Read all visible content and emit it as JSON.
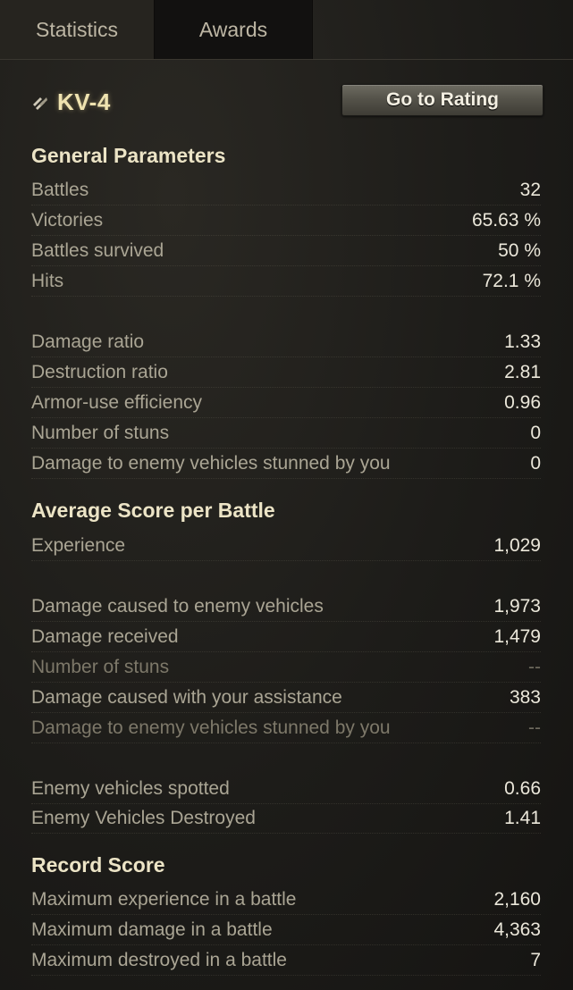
{
  "tabs": [
    {
      "label": "Statistics"
    },
    {
      "label": "Awards"
    }
  ],
  "vehicle": {
    "name": "KV-4",
    "icon": "heavy-tank-icon"
  },
  "rating_button": {
    "label": "Go to Rating"
  },
  "general": {
    "title": "General Parameters",
    "rows": [
      {
        "label": "Battles",
        "value": "32"
      },
      {
        "label": "Victories",
        "value": "65.63 %"
      },
      {
        "label": "Battles survived",
        "value": "50 %"
      },
      {
        "label": "Hits",
        "value": "72.1 %"
      },
      {
        "label": "Damage ratio",
        "value": "1.33"
      },
      {
        "label": "Destruction ratio",
        "value": "2.81"
      },
      {
        "label": "Armor-use efficiency",
        "value": "0.96"
      },
      {
        "label": "Number of stuns",
        "value": "0"
      },
      {
        "label": "Damage to enemy vehicles stunned by you",
        "value": "0"
      }
    ]
  },
  "average": {
    "title": "Average Score per Battle",
    "rows": [
      {
        "label": "Experience",
        "value": "1,029"
      },
      {
        "label": "Damage caused to enemy vehicles",
        "value": "1,973"
      },
      {
        "label": "Damage received",
        "value": "1,479"
      },
      {
        "label": "Number of stuns",
        "value": "--"
      },
      {
        "label": "Damage caused with your assistance",
        "value": "383"
      },
      {
        "label": "Damage to enemy vehicles stunned by you",
        "value": "--"
      },
      {
        "label": "Enemy vehicles spotted",
        "value": "0.66"
      },
      {
        "label": "Enemy Vehicles Destroyed",
        "value": "1.41"
      }
    ]
  },
  "record": {
    "title": "Record Score",
    "rows": [
      {
        "label": "Maximum experience in a battle",
        "value": "2,160"
      },
      {
        "label": "Maximum damage in a battle",
        "value": "4,363"
      },
      {
        "label": "Maximum destroyed in a battle",
        "value": "7"
      }
    ]
  }
}
